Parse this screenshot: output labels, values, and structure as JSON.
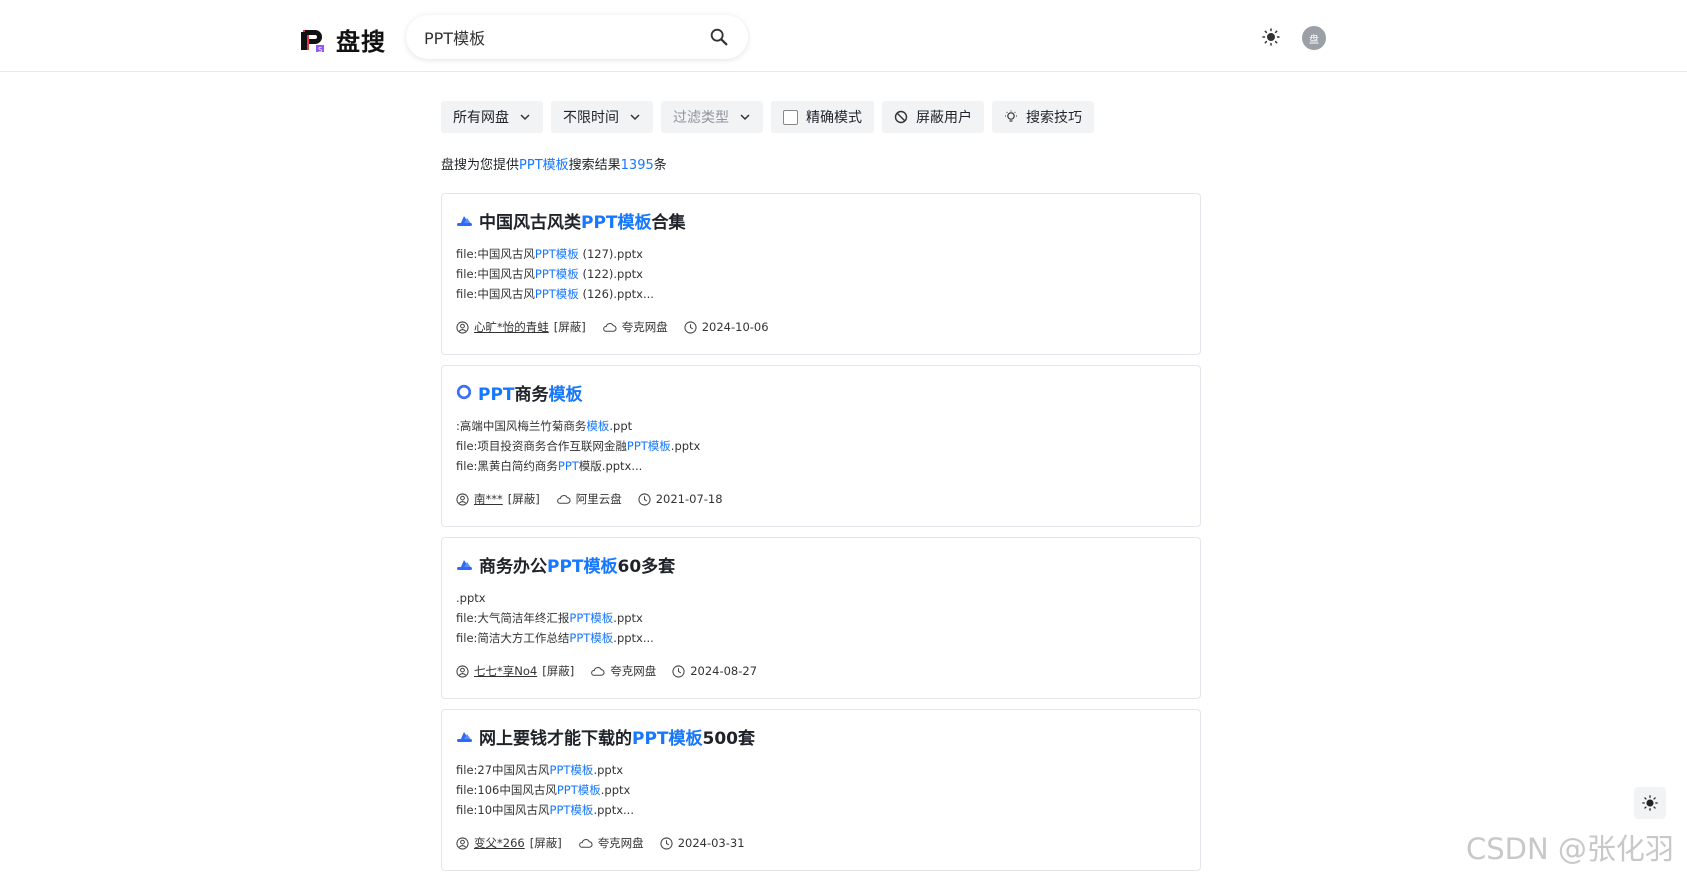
{
  "header": {
    "logo_text": "盘搜",
    "search_value": "PPT模板",
    "avatar_text": "盘"
  },
  "filters": [
    {
      "label": "所有网盘",
      "icon": "chevron-down-icon"
    },
    {
      "label": "不限时间",
      "icon": "chevron-down-icon"
    },
    {
      "label": "过滤类型",
      "icon": "chevron-down-icon"
    },
    {
      "label": "精确模式",
      "icon": "checkbox"
    },
    {
      "label": "屏蔽用户",
      "icon": "ban-icon"
    },
    {
      "label": "搜索技巧",
      "icon": "lightbulb-icon"
    }
  ],
  "result_summary": {
    "prefix": "盘搜为您提供",
    "keyword": "PPT模板",
    "middle": "搜索结果",
    "count": "1395",
    "suffix": "条"
  },
  "results": [
    {
      "icon": "quark-cloud-icon",
      "title": [
        {
          "t": "中国风古风类",
          "h": false
        },
        {
          "t": "PPT模板",
          "h": true
        },
        {
          "t": "合集",
          "h": false
        }
      ],
      "files": [
        [
          {
            "t": "file:中国风古风",
            "h": false
          },
          {
            "t": "PPT模板",
            "h": true
          },
          {
            "t": " (127).pptx",
            "h": false
          }
        ],
        [
          {
            "t": "file:中国风古风",
            "h": false
          },
          {
            "t": "PPT模板",
            "h": true
          },
          {
            "t": " (122).pptx",
            "h": false
          }
        ],
        [
          {
            "t": "file:中国风古风",
            "h": false
          },
          {
            "t": "PPT模板",
            "h": true
          },
          {
            "t": " (126).pptx...",
            "h": false
          }
        ]
      ],
      "user": "心旷*怡的青蛙",
      "block": "[屏蔽]",
      "disk": "夸克网盘",
      "date": "2024-10-06"
    },
    {
      "icon": "aliyun-ring-icon",
      "title": [
        {
          "t": "PPT",
          "h": true
        },
        {
          "t": "商务",
          "h": false
        },
        {
          "t": "模板",
          "h": true
        }
      ],
      "files": [
        [
          {
            "t": ":高端中国风梅兰竹菊商务",
            "h": false
          },
          {
            "t": "模板",
            "h": true
          },
          {
            "t": ".ppt",
            "h": false
          }
        ],
        [
          {
            "t": "file:项目投资商务合作互联网金融",
            "h": false
          },
          {
            "t": "PPT模板",
            "h": true
          },
          {
            "t": ".pptx",
            "h": false
          }
        ],
        [
          {
            "t": "file:黑黄白简约商务",
            "h": false
          },
          {
            "t": "PPT",
            "h": true
          },
          {
            "t": "模版.pptx...",
            "h": false
          }
        ]
      ],
      "user": "南***",
      "block": "[屏蔽]",
      "disk": "阿里云盘",
      "date": "2021-07-18"
    },
    {
      "icon": "quark-cloud-icon",
      "title": [
        {
          "t": "商务办公",
          "h": false
        },
        {
          "t": "PPT模板",
          "h": true
        },
        {
          "t": "60多套",
          "h": false
        }
      ],
      "files": [
        [
          {
            "t": ".pptx",
            "h": false
          }
        ],
        [
          {
            "t": "file:大气简洁年终汇报",
            "h": false
          },
          {
            "t": "PPT模板",
            "h": true
          },
          {
            "t": ".pptx",
            "h": false
          }
        ],
        [
          {
            "t": "file:简洁大方工作总结",
            "h": false
          },
          {
            "t": "PPT模板",
            "h": true
          },
          {
            "t": ".pptx...",
            "h": false
          }
        ]
      ],
      "user": "七七*享No4",
      "block": "[屏蔽]",
      "disk": "夸克网盘",
      "date": "2024-08-27"
    },
    {
      "icon": "quark-cloud-icon",
      "title": [
        {
          "t": "网上要钱才能下载的",
          "h": false
        },
        {
          "t": "PPT模板",
          "h": true
        },
        {
          "t": "500套",
          "h": false
        }
      ],
      "files": [
        [
          {
            "t": "file:27中国风古风",
            "h": false
          },
          {
            "t": "PPT模板",
            "h": true
          },
          {
            "t": ".pptx",
            "h": false
          }
        ],
        [
          {
            "t": "file:106中国风古风",
            "h": false
          },
          {
            "t": "PPT模板",
            "h": true
          },
          {
            "t": ".pptx",
            "h": false
          }
        ],
        [
          {
            "t": "file:10中国风古风",
            "h": false
          },
          {
            "t": "PPT模板",
            "h": true
          },
          {
            "t": ".pptx...",
            "h": false
          }
        ]
      ],
      "user": "变父*266",
      "block": "[屏蔽]",
      "disk": "夸克网盘",
      "date": "2024-03-31"
    }
  ],
  "watermark": "CSDN @张化羽",
  "colors": {
    "highlight": "#1677ff",
    "quark": "#2e6bf5",
    "aliyun": "#3b6ef6"
  }
}
